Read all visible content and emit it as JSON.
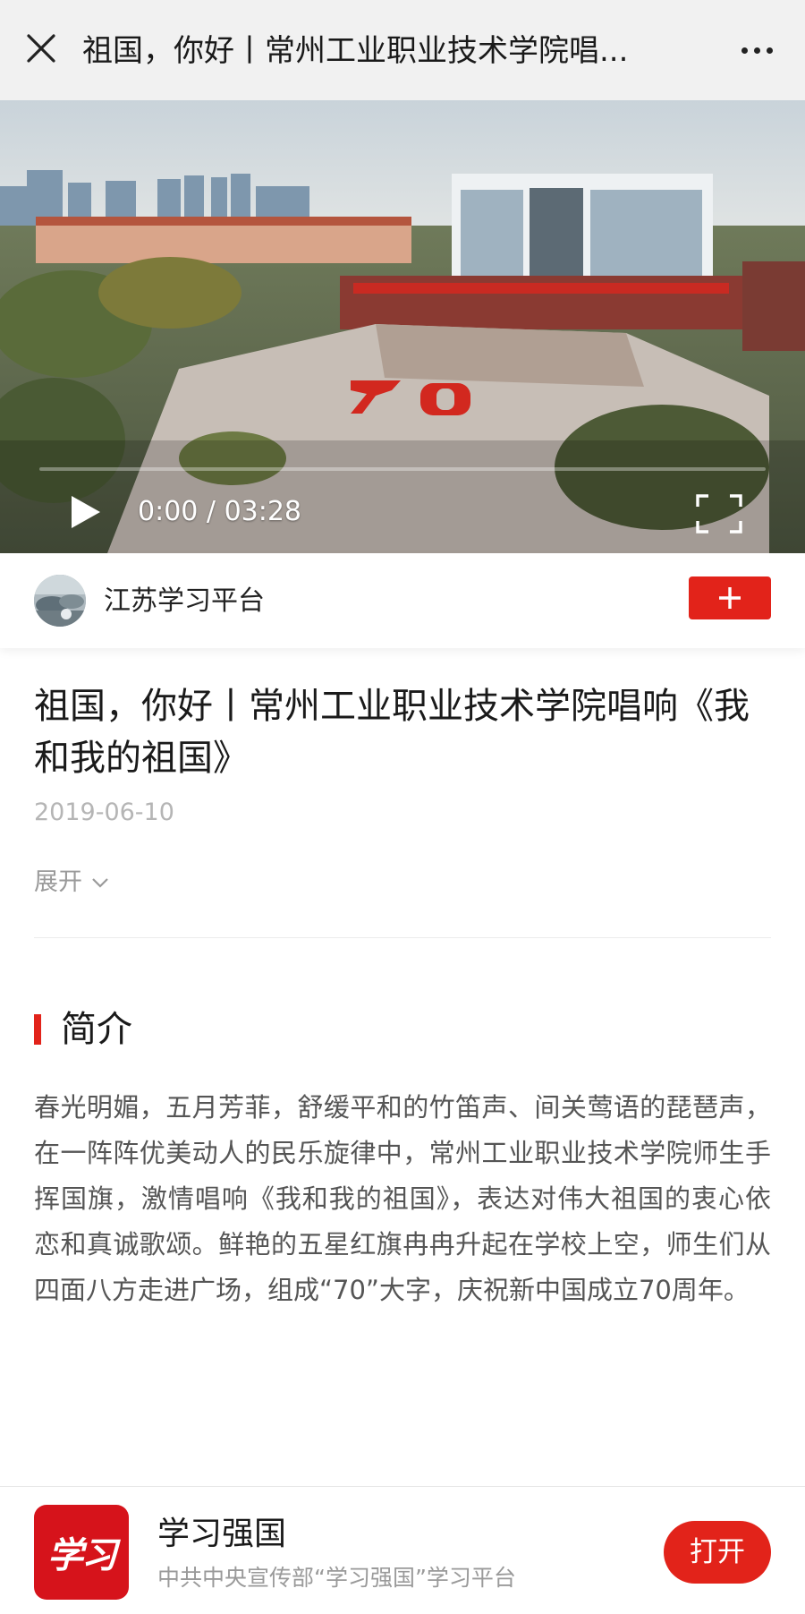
{
  "topbar": {
    "title": "祖国，你好丨常州工业职业技术学院唱...",
    "close_icon": "close-icon",
    "more_icon": "more-dots-icon"
  },
  "video": {
    "current_time": "0:00",
    "separator": " / ",
    "duration": "03:28",
    "progress": 0,
    "play_icon": "play-icon",
    "fullscreen_icon": "fullscreen-icon"
  },
  "channel": {
    "name": "江苏学习平台",
    "follow_icon": "plus-icon"
  },
  "article": {
    "title": "祖国，你好丨常州工业职业技术学院唱响《我和我的祖国》",
    "date": "2019-06-10",
    "expand_label": "展开"
  },
  "intro": {
    "heading": "简介",
    "text": "春光明媚，五月芳菲，舒缓平和的竹笛声、间关莺语的琵琶声，在一阵阵优美动人的民乐旋律中，常州工业职业技术学院师生手挥国旗，激情唱响《我和我的祖国》，表达对伟大祖国的衷心依恋和真诚歌颂。鲜艳的五星红旗冉冉升起在学校上空，师生们从四面八方走进广场，组成“70”大字，庆祝新中国成立70周年。"
  },
  "app_banner": {
    "logo_text": "学习",
    "name": "学习强国",
    "description": "中共中央宣传部“学习强国”学习平台",
    "open_label": "打开"
  },
  "colors": {
    "accent_red": "#e2231a",
    "topbar_bg": "#f1f1f1",
    "muted_text": "#9a9a9a"
  }
}
